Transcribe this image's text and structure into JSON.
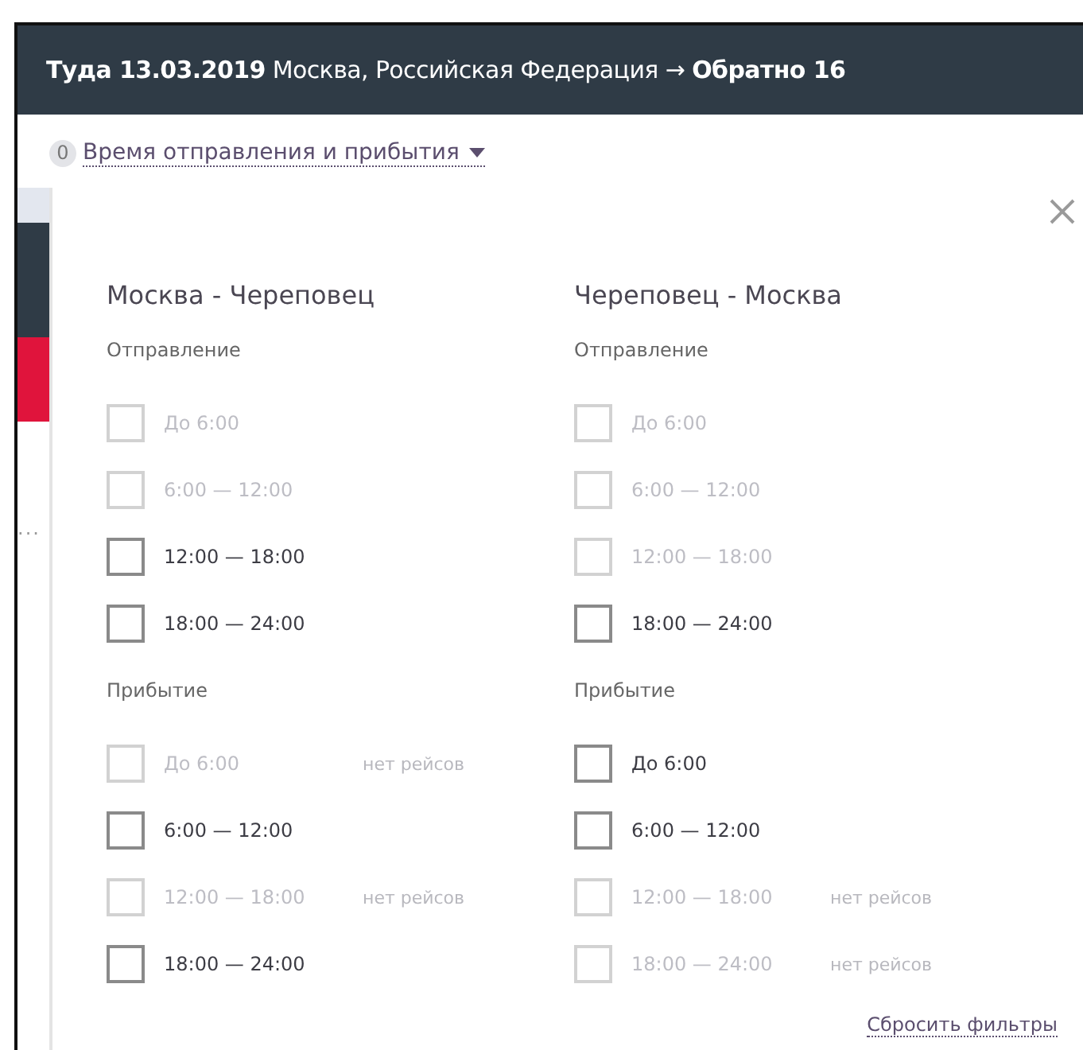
{
  "header": {
    "title": "**Туда 13.03.2019** Москва, Российская Федерация → **Обратно 16**"
  },
  "filter_toggle": {
    "count": "0",
    "label": "Время отправления и прибытия",
    "expanded": true
  },
  "background_hint": {
    "ellipsis": "..."
  },
  "columns": [
    {
      "title": "Москва - Череповец",
      "sections": [
        {
          "label": "Отправление",
          "options": [
            {
              "label": "До 6:00",
              "checked": false,
              "disabled": true
            },
            {
              "label": "6:00 — 12:00",
              "checked": false,
              "disabled": true
            },
            {
              "label": "12:00 — 18:00",
              "checked": false,
              "disabled": false
            },
            {
              "label": "18:00 — 24:00",
              "checked": false,
              "disabled": false
            }
          ]
        },
        {
          "label": "Прибытие",
          "options": [
            {
              "label": "До 6:00",
              "checked": false,
              "disabled": true,
              "note": "нет рейсов"
            },
            {
              "label": "6:00 — 12:00",
              "checked": false,
              "disabled": false
            },
            {
              "label": "12:00 — 18:00",
              "checked": false,
              "disabled": true,
              "note": "нет рейсов"
            },
            {
              "label": "18:00 — 24:00",
              "checked": false,
              "disabled": false
            }
          ]
        }
      ]
    },
    {
      "title": "Череповец - Москва",
      "sections": [
        {
          "label": "Отправление",
          "options": [
            {
              "label": "До 6:00",
              "checked": false,
              "disabled": true
            },
            {
              "label": "6:00 — 12:00",
              "checked": false,
              "disabled": true
            },
            {
              "label": "12:00 — 18:00",
              "checked": false,
              "disabled": true
            },
            {
              "label": "18:00 — 24:00",
              "checked": false,
              "disabled": false
            }
          ]
        },
        {
          "label": "Прибытие",
          "options": [
            {
              "label": "До 6:00",
              "checked": false,
              "disabled": false
            },
            {
              "label": "6:00 — 12:00",
              "checked": false,
              "disabled": false
            },
            {
              "label": "12:00 — 18:00",
              "checked": false,
              "disabled": true,
              "note": "нет рейсов"
            },
            {
              "label": "18:00 — 24:00",
              "checked": false,
              "disabled": true,
              "note": "нет рейсов"
            }
          ]
        }
      ]
    }
  ],
  "reset_link": "Сбросить фильтры"
}
